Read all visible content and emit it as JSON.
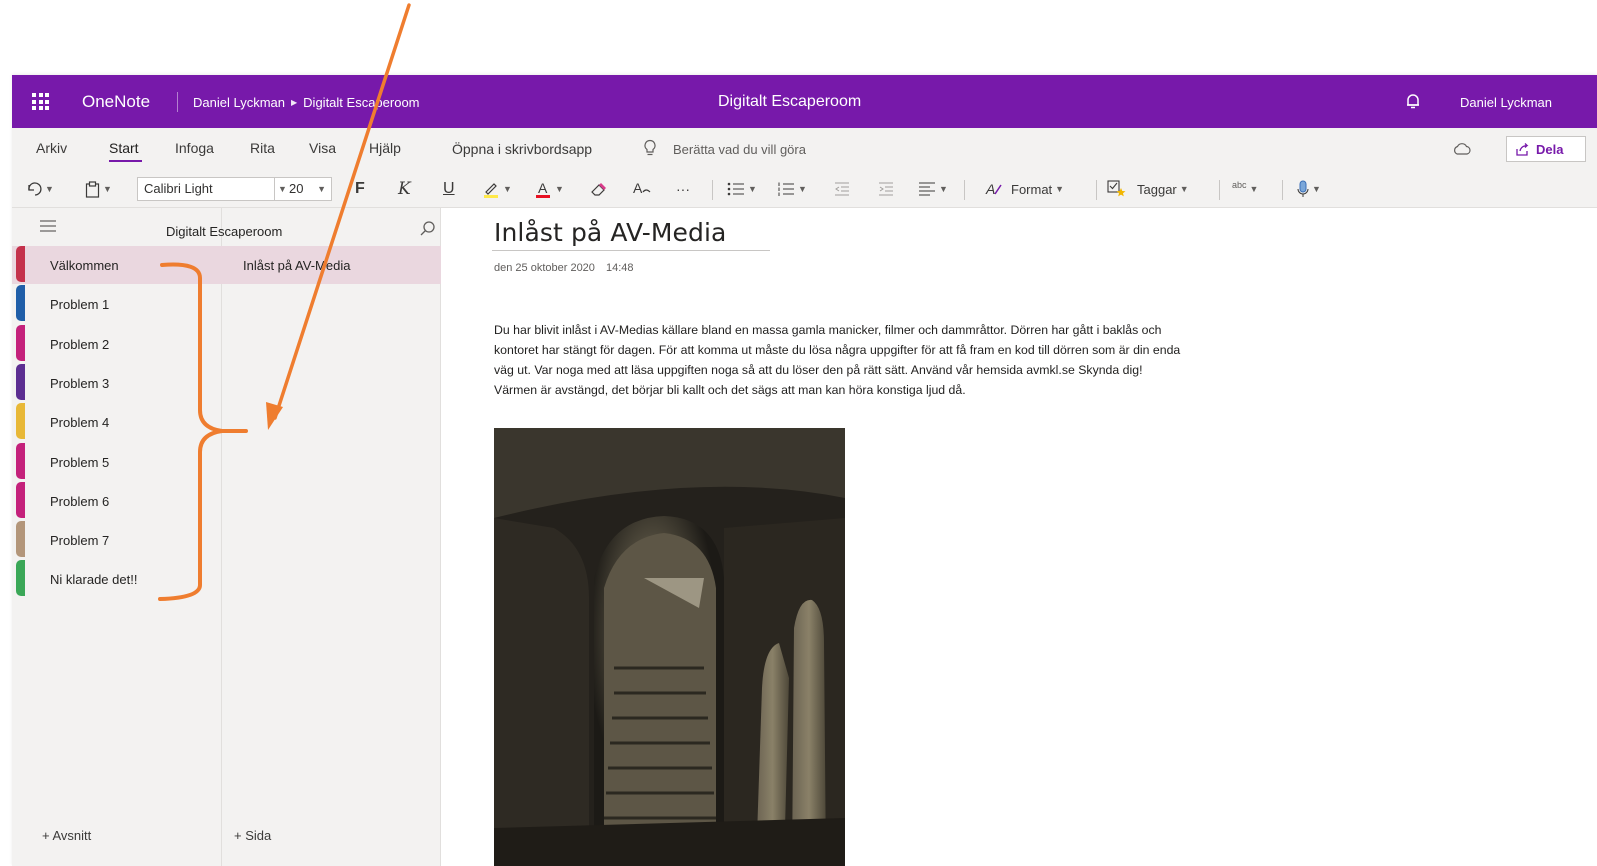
{
  "titlebar": {
    "app_name": "OneNote",
    "breadcrumb_user": "Daniel Lyckman",
    "breadcrumb_notebook": "Digitalt Escaperoom",
    "doc_title": "Digitalt Escaperoom",
    "user_name": "Daniel Lyckman",
    "accent_color": "#7719aa"
  },
  "menu": {
    "tabs": [
      "Arkiv",
      "Start",
      "Infoga",
      "Rita",
      "Visa",
      "Hjälp"
    ],
    "active_tab": "Start",
    "open_desktop": "Öppna i skrivbordsapp",
    "tell_me": "Berätta vad du vill göra",
    "share_label": "Dela"
  },
  "toolbar": {
    "font_name": "Calibri Light",
    "font_size": "20",
    "bold": "F",
    "italic": "K",
    "underline": "U",
    "more": "···",
    "format_label": "Format",
    "tags_label": "Taggar",
    "spell_label": "abc"
  },
  "sections": {
    "notebook_name": "Digitalt Escaperoom",
    "items": [
      {
        "label": "Välkommen",
        "color": "#c4314b"
      },
      {
        "label": "Problem 1",
        "color": "#1f5ea8"
      },
      {
        "label": "Problem 2",
        "color": "#c4217b"
      },
      {
        "label": "Problem 3",
        "color": "#5c2e91"
      },
      {
        "label": "Problem 4",
        "color": "#e8b837"
      },
      {
        "label": "Problem 5",
        "color": "#c4217b"
      },
      {
        "label": "Problem 6",
        "color": "#c4217b"
      },
      {
        "label": "Problem 7",
        "color": "#b3967a"
      },
      {
        "label": "Ni klarade det!!",
        "color": "#3aa757"
      }
    ],
    "selected_index": 0,
    "add_label": "+ Avsnitt"
  },
  "pages": {
    "items": [
      {
        "label": "Inlåst på AV-Media"
      }
    ],
    "selected_index": 0,
    "add_label": "+ Sida"
  },
  "page": {
    "title": "Inlåst på AV-Media",
    "date": "den 25 oktober 2020",
    "time": "14:48",
    "body": "Du har blivit inlåst i AV-Medias källare bland en massa gamla manicker, filmer och dammråttor. Dörren har gått i baklås och kontoret har stängt för dagen. För att komma ut måste du lösa några uppgifter för att få fram en kod till dörren som är din enda väg ut. Var noga med att läsa uppgiften noga så att du löser den på rätt sätt. Använd vår hemsida avmkl.se  Skynda dig! Värmen är avstängd, det börjar bli kallt och det sägs att man kan höra konstiga ljud då."
  },
  "annotation": {
    "color": "#ef7d2f"
  }
}
